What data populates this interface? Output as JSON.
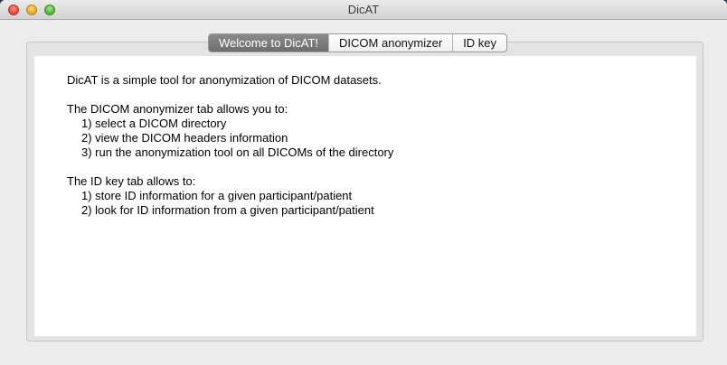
{
  "window": {
    "title": "DicAT"
  },
  "tabs": [
    {
      "label": "Welcome to DicAT!",
      "active": true
    },
    {
      "label": "DICOM anonymizer",
      "active": false
    },
    {
      "label": "ID key",
      "active": false
    }
  ],
  "welcome": {
    "intro": "DicAT is a simple tool for anonymization of DICOM datasets.",
    "anonymizer_heading": "The DICOM anonymizer tab allows you to:",
    "anonymizer_items": [
      "1) select a DICOM directory",
      "2) view the DICOM headers information",
      "3) run the anonymization tool on all DICOMs of the directory"
    ],
    "idkey_heading": "The ID key tab allows to:",
    "idkey_items": [
      "1) store ID information for a given participant/patient",
      "2) look for ID information from a given participant/patient"
    ]
  }
}
